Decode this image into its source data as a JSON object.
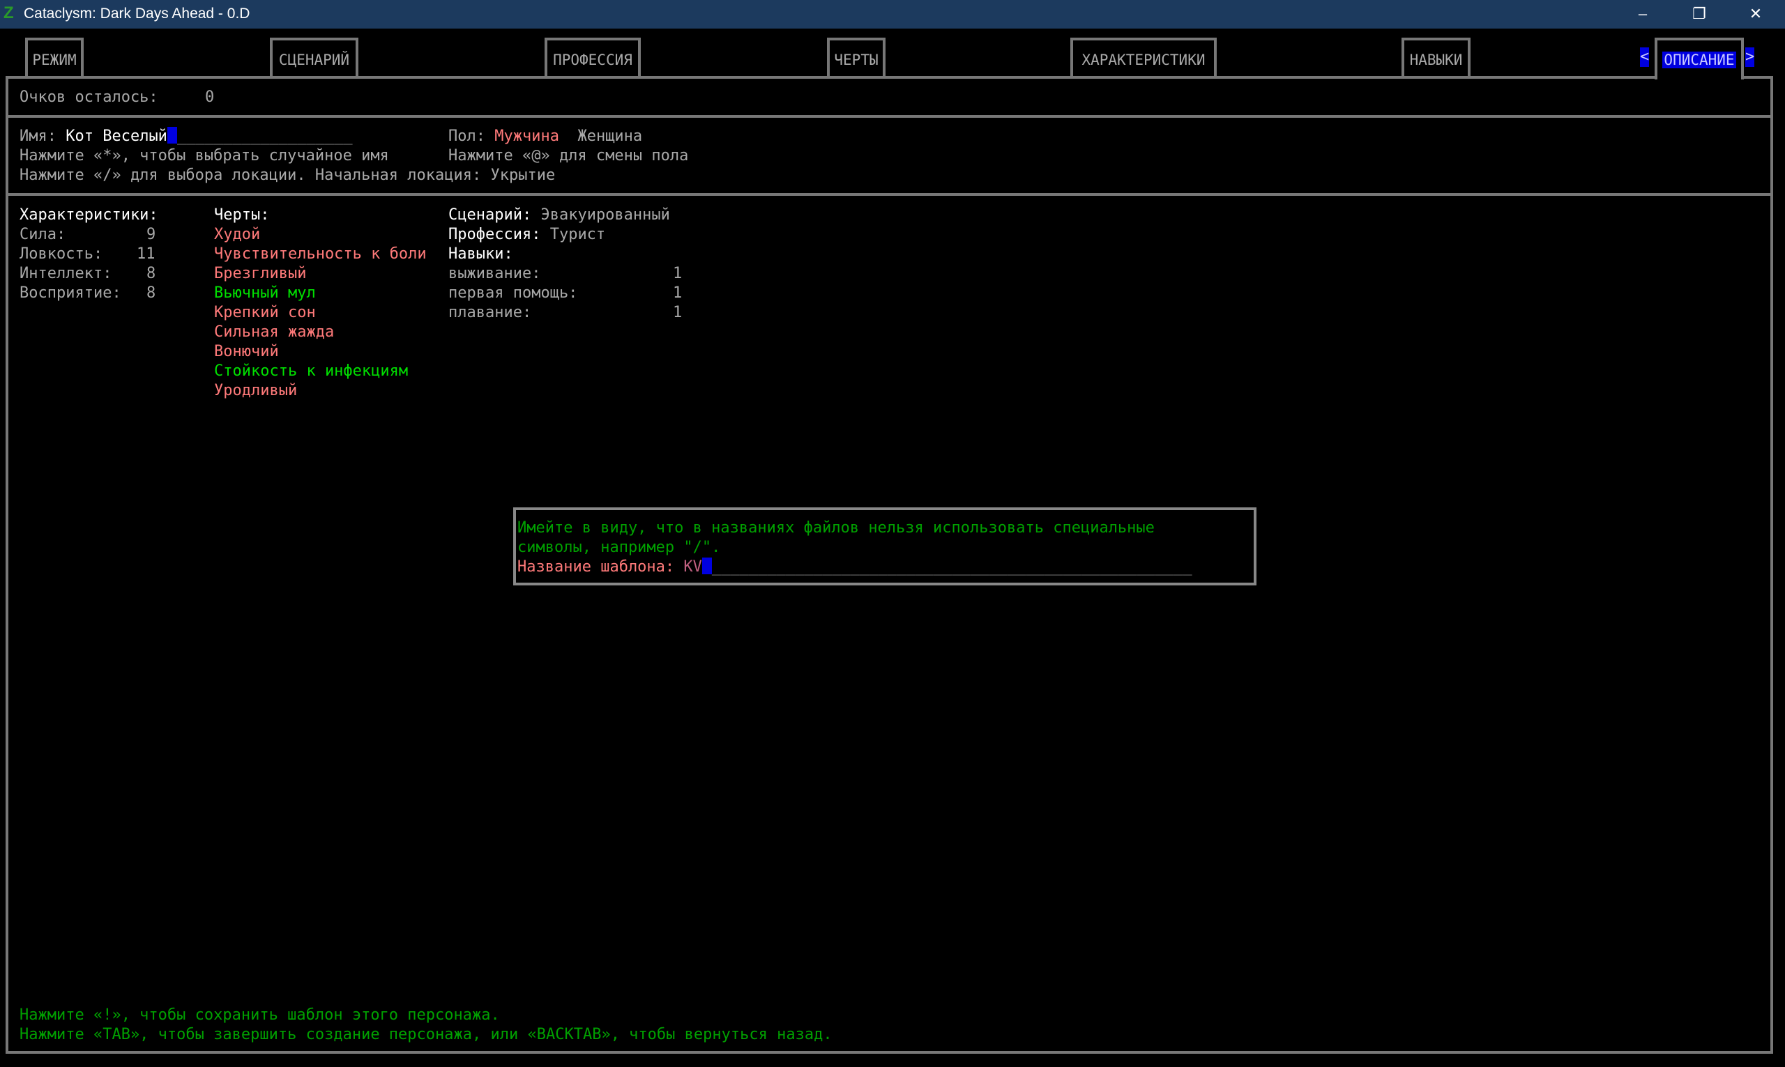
{
  "window": {
    "title": "Cataclysm: Dark Days Ahead - 0.D",
    "minimize": "–",
    "restore": "❐",
    "close": "✕"
  },
  "tabs": [
    {
      "label": "РЕЖИМ"
    },
    {
      "label": "СЦЕНАРИЙ"
    },
    {
      "label": "ПРОФЕССИЯ"
    },
    {
      "label": "ЧЕРТЫ"
    },
    {
      "label": "ХАРАКТЕРИСТИКИ"
    },
    {
      "label": "НАВЫКИ"
    },
    {
      "label": "ОПИСАНИЕ",
      "active": true
    }
  ],
  "tab_arrows": {
    "left": "<",
    "right": ">"
  },
  "points": {
    "label": "Очков осталось:",
    "value": "0"
  },
  "name": {
    "label": "Имя:",
    "value": "Кот Веселый",
    "underscores": "___________________",
    "hint_random": "Нажмите «*», чтобы выбрать случайное имя",
    "hint_location": "Нажмите «/» для выбора локации. Начальная локация: Укрытие"
  },
  "gender": {
    "label": "Пол:",
    "selected": "Мужчина",
    "other": "Женщина",
    "hint": "Нажмите «@» для смены пола"
  },
  "stats": {
    "header": "Характеристики:",
    "items": [
      {
        "label": "Сила:",
        "value": "9"
      },
      {
        "label": "Ловкость:",
        "value": "11"
      },
      {
        "label": "Интеллект:",
        "value": "8"
      },
      {
        "label": "Восприятие:",
        "value": "8"
      }
    ]
  },
  "traits": {
    "header": "Черты:",
    "items": [
      {
        "label": "Худой",
        "type": "bad"
      },
      {
        "label": "Чувствительность к боли",
        "type": "bad"
      },
      {
        "label": "Брезгливый",
        "type": "bad"
      },
      {
        "label": "Вьючный мул",
        "type": "good"
      },
      {
        "label": "Крепкий сон",
        "type": "bad"
      },
      {
        "label": "Сильная жажда",
        "type": "bad"
      },
      {
        "label": "Вонючий",
        "type": "bad"
      },
      {
        "label": "Стойкость к инфекциям",
        "type": "good"
      },
      {
        "label": "Уродливый",
        "type": "bad"
      }
    ]
  },
  "scenario": {
    "label": "Сценарий:",
    "value": "Эвакуированный"
  },
  "profession": {
    "label": "Профессия:",
    "value": "Турист"
  },
  "skills": {
    "header": "Навыки:",
    "items": [
      {
        "label": "выживание:",
        "value": "1"
      },
      {
        "label": "первая помощь:",
        "value": "1"
      },
      {
        "label": "плавание:",
        "value": "1"
      }
    ]
  },
  "popup": {
    "line1": "Имейте в виду, что в названиях файлов нельзя использовать специальные",
    "line2": "символы, например \"/\".",
    "label": "Название шаблона:",
    "value": "KV",
    "underscores": "____________________________________________________"
  },
  "footer": {
    "line1": "Нажмите «!», чтобы сохранить шаблон этого персонажа.",
    "line2": "Нажмите «TAB», чтобы завершить создание персонажа, или «BACKTAB», чтобы вернуться назад."
  },
  "colors": {
    "bad": "#ff7a7a",
    "good": "#00e000",
    "highlight": "#0000e0",
    "titlebar": "#1c3a5e"
  }
}
